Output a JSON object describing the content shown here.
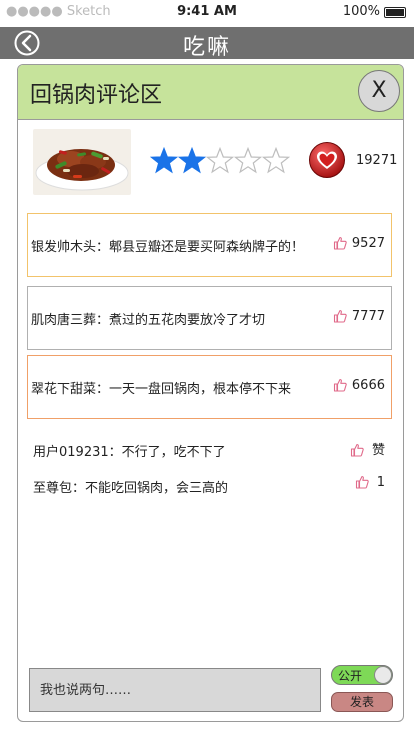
{
  "status_bar": {
    "carrier": "●●●●● Sketch",
    "time": "9:41 AM",
    "battery": "100%"
  },
  "nav": {
    "title": "吃嘛"
  },
  "panel": {
    "title": "回锅肉评论区",
    "close_label": "X",
    "rating": {
      "value": 2,
      "max": 5
    },
    "heart_count": "19271"
  },
  "comments": [
    {
      "text": "银发帅木头：郫县豆瓣还是要买阿森纳牌子的！",
      "likes": "9527"
    },
    {
      "text": "肌肉唐三葬：煮过的五花肉要放冷了才切",
      "likes": "7777"
    },
    {
      "text": "翠花下甜菜：一天一盘回锅肉，根本停不下来",
      "likes": "6666"
    },
    {
      "text": "用户019231：不行了，吃不下了",
      "likes": "赞"
    },
    {
      "text": "至尊包：不能吃回锅肉，会三高的",
      "likes": "1"
    }
  ],
  "composer": {
    "placeholder": "我也说两句……",
    "toggle_label": "公开",
    "publish_label": "发表"
  },
  "colors": {
    "header_green": "#c6e39b",
    "star_blue": "#1a73e8",
    "heart_red": "#d21f1f"
  }
}
